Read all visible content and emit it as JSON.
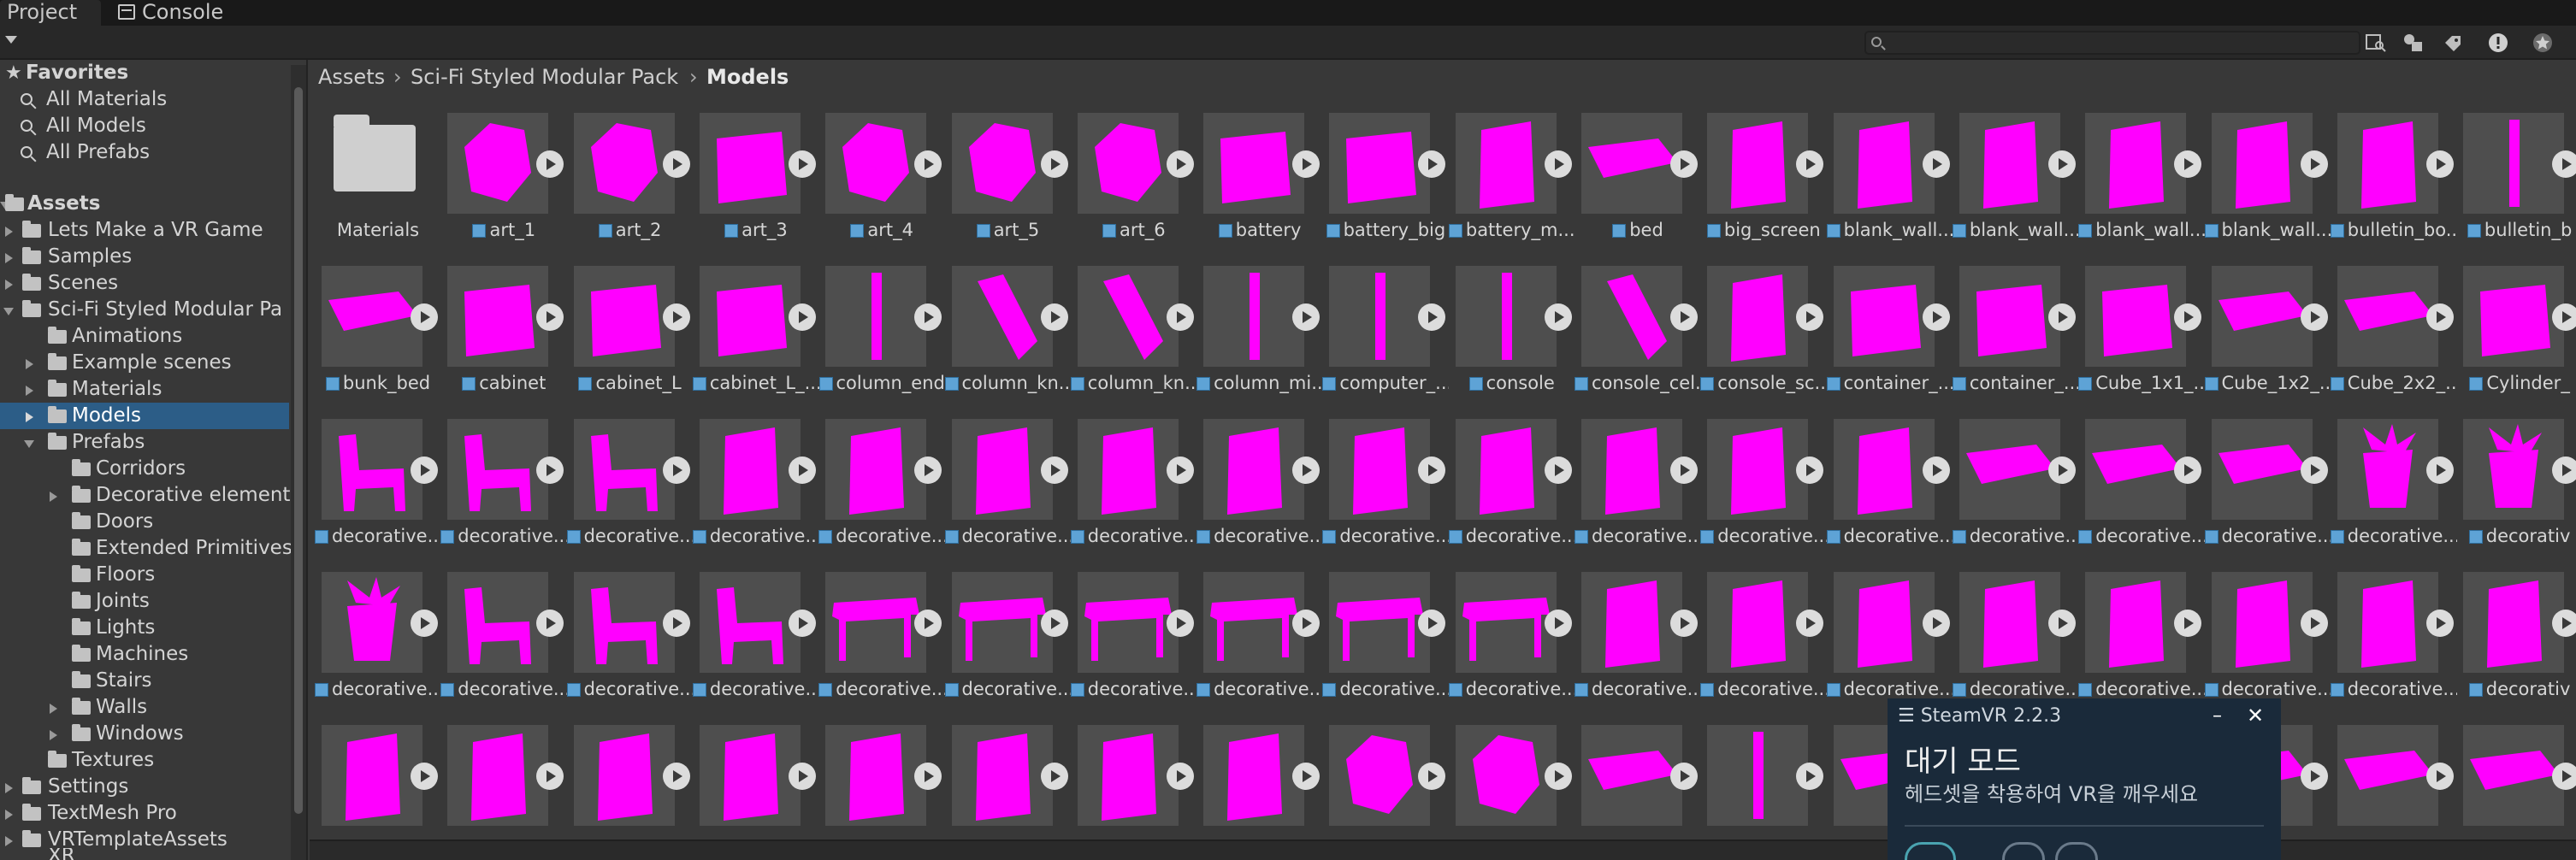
{
  "tabs": {
    "project": "Project",
    "console": "Console"
  },
  "toolbar": {
    "search_placeholder": ""
  },
  "tree": {
    "favorites_label": "Favorites",
    "favorites": [
      "All Materials",
      "All Models",
      "All Prefabs"
    ],
    "assets_label": "Assets",
    "assets_children": [
      "Lets Make a VR Game",
      "Samples",
      "Scenes",
      "Sci-Fi Styled Modular Pa"
    ],
    "scifi_children": [
      "Animations",
      "Example scenes",
      "Materials",
      "Models",
      "Prefabs"
    ],
    "prefabs_children": [
      "Corridors",
      "Decorative elements",
      "Doors",
      "Extended Primitives",
      "Floors",
      "Joints",
      "Lights",
      "Machines",
      "Stairs",
      "Walls",
      "Windows"
    ],
    "textures": "Textures",
    "bottom_items": [
      "Settings",
      "TextMesh Pro",
      "VRTemplateAssets",
      "XR"
    ]
  },
  "breadcrumb": {
    "root": "Assets",
    "pack": "Sci-Fi Styled Modular Pack",
    "current": "Models"
  },
  "grid": {
    "rows": [
      [
        "Materials",
        "art_1",
        "art_2",
        "art_3",
        "art_4",
        "art_5",
        "art_6",
        "battery",
        "battery_big",
        "battery_m...",
        "bed",
        "big_screen",
        "blank_wall...",
        "blank_wall...",
        "blank_wall...",
        "blank_wall...",
        "bulletin_bo...",
        "bulletin_b"
      ],
      [
        "bunk_bed",
        "cabinet",
        "cabinet_L",
        "cabinet_L_...",
        "column_end",
        "column_kn...",
        "column_kn...",
        "column_mi...",
        "computer_...",
        "console",
        "console_cel...",
        "console_sc...",
        "container_...",
        "container_...",
        "Cube_1x1_...",
        "Cube_1x2_...",
        "Cube_2x2_...",
        "Cylinder_"
      ],
      [
        "decorative...",
        "decorative...",
        "decorative...",
        "decorative...",
        "decorative...",
        "decorative...",
        "decorative...",
        "decorative...",
        "decorative...",
        "decorative...",
        "decorative...",
        "decorative...",
        "decorative...",
        "decorative...",
        "decorative...",
        "decorative...",
        "decorative...",
        "decorativ"
      ],
      [
        "decorative...",
        "decorative...",
        "decorative...",
        "decorative...",
        "decorative...",
        "decorative...",
        "decorative...",
        "decorative...",
        "decorative...",
        "decorative...",
        "decorative...",
        "decorative...",
        "decorative...",
        "decorative...",
        "decorative...",
        "decorative...",
        "decorative...",
        "decorativ"
      ],
      [
        "",
        "",
        "",
        "",
        "",
        "",
        "",
        "",
        "",
        "",
        "",
        "",
        "",
        "",
        "",
        "",
        "",
        ""
      ]
    ]
  },
  "steamvr": {
    "title": "SteamVR 2.2.3",
    "minimize": "–",
    "close": "✕",
    "heading": "대기 모드",
    "message": "헤드셋을 착용하여 VR을 깨우세요"
  },
  "colors": {
    "accent": "#2c5d87",
    "missing_material": "#ff00ff"
  }
}
